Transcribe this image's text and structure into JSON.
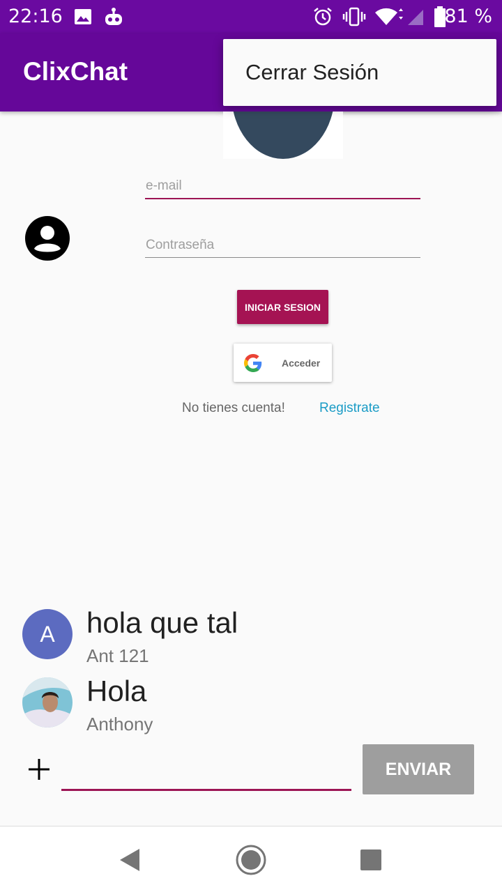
{
  "status_bar": {
    "time": "22:16",
    "battery_percent": "81 %",
    "icons": [
      "image-icon",
      "robot-icon",
      "alarm-icon",
      "vibrate-icon",
      "wifi-icon",
      "signal-icon",
      "battery-icon"
    ]
  },
  "app_bar": {
    "title": "ClixChat",
    "background": "#650799"
  },
  "overflow_menu": {
    "items": [
      {
        "label": "Cerrar Sesión"
      }
    ]
  },
  "login": {
    "email_placeholder": "e-mail",
    "email_value": "",
    "password_placeholder": "Contraseña",
    "password_value": "",
    "login_button": "INICIAR SESION",
    "google_button": "Acceder",
    "no_account_text": "No tienes cuenta!",
    "register_link": "Registrate",
    "accent_color": "#a51353",
    "link_color": "#1b9cc6"
  },
  "messages": [
    {
      "text": "hola que tal",
      "user": "Ant 121",
      "avatar_letter": "A",
      "avatar_color": "#5c6bc0"
    },
    {
      "text": "Hola",
      "user": "Anthony",
      "avatar_letter": "",
      "avatar_type": "photo"
    }
  ],
  "composer": {
    "input_value": "",
    "send_button": "ENVIAR",
    "send_button_color": "#9e9e9e"
  },
  "nav_bar": {
    "buttons": [
      "back-icon",
      "home-icon",
      "recents-icon"
    ]
  }
}
